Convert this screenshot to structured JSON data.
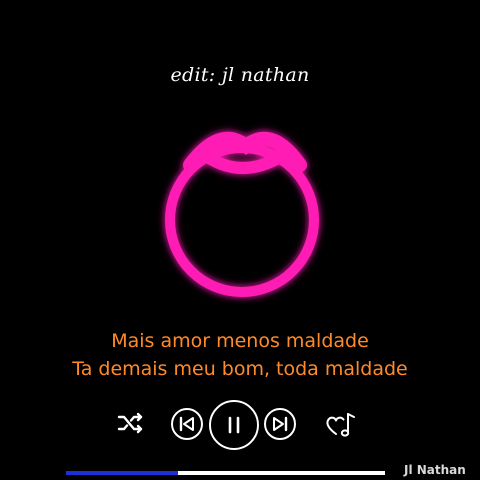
{
  "credit": "edit: jl nathan",
  "lyrics": {
    "line1": "Mais amor menos maldade",
    "line2": "Ta demais meu bom, toda maldade"
  },
  "controls": {
    "shuffle_icon": "shuffle-icon",
    "prev_icon": "skip-previous-icon",
    "play_icon": "pause-icon",
    "next_icon": "skip-next-icon",
    "like_icon": "heart-music-note-icon"
  },
  "progress": {
    "fraction": 0.35
  },
  "artist": "Jl Nathan",
  "colors": {
    "background": "#000000",
    "visualizer": "#ff1fb4",
    "lyrics": "#ff8a2a",
    "controls": "#ffffff",
    "progress_fill": "#1f2fd6",
    "progress_track": "#ffffff"
  }
}
